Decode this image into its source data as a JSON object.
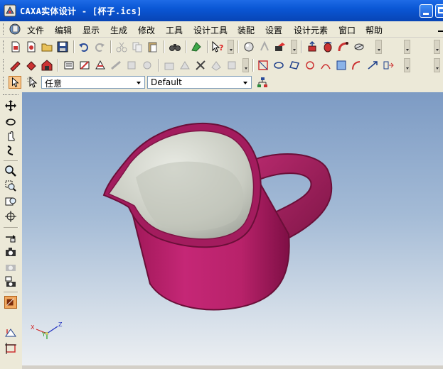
{
  "window": {
    "title": "CAXA实体设计 - [杯子.ics]"
  },
  "menu": [
    "文件",
    "编辑",
    "显示",
    "生成",
    "修改",
    "工具",
    "设计工具",
    "装配",
    "设置",
    "设计元素",
    "窗口",
    "帮助"
  ],
  "toolbar3": {
    "filter_value": "任意",
    "style_value": "Default"
  },
  "axis": {
    "x": "X",
    "y": "Y",
    "z": "Z"
  },
  "colors": {
    "titlebar": "#0A57D5",
    "model": "#B8226A",
    "viewport_top": "#7D9BC4"
  }
}
